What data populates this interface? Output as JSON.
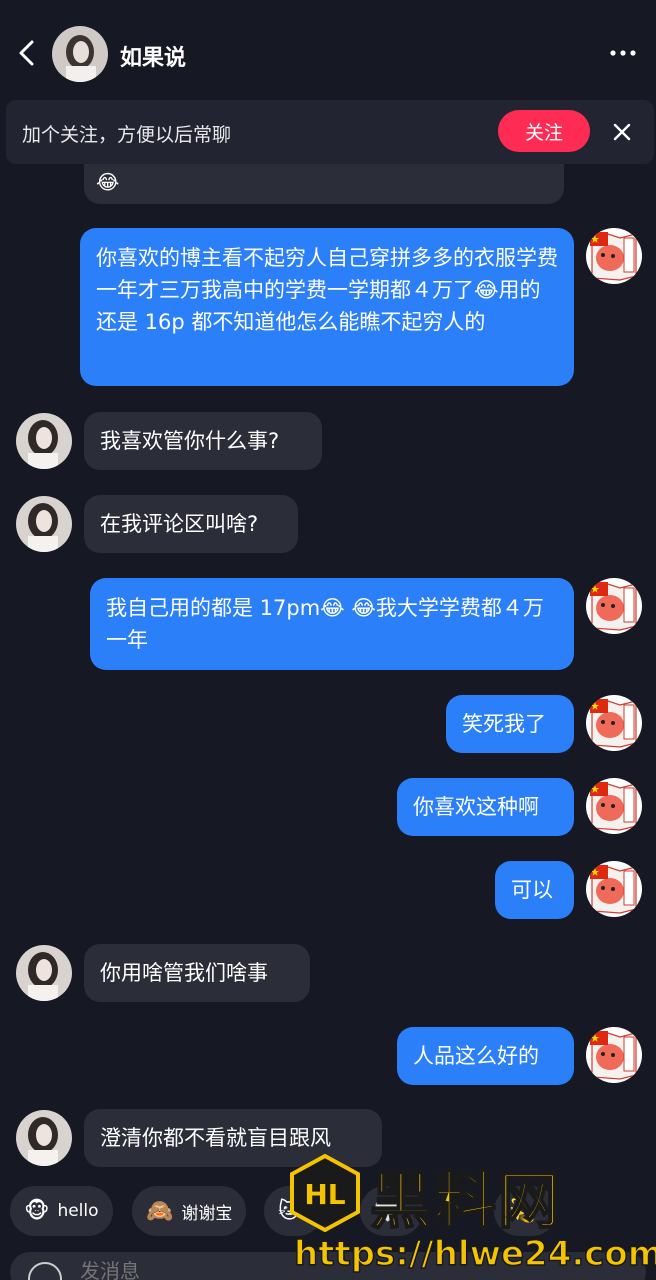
{
  "header": {
    "contact_name": "如果说"
  },
  "follow_banner": {
    "text": "加个关注，方便以后常聊",
    "button_label": "关注"
  },
  "partial_message": {
    "emoji": "😂"
  },
  "messages": [
    {
      "from": "me",
      "text": "你喜欢的博主看不起穷人自己穿拼多多的衣服学费一年才三万我高中的学费一学期都４万了😂用的还是 16p 都不知道他怎么能瞧不起穷人的"
    },
    {
      "from": "them",
      "text": "我喜欢管你什么事?"
    },
    {
      "from": "them",
      "text": "在我评论区叫啥?"
    },
    {
      "from": "me",
      "text": "我自己用的都是 17pm😂 😂我大学学费都４万一年"
    },
    {
      "from": "me",
      "text": "笑死我了"
    },
    {
      "from": "me",
      "text": "你喜欢这种啊"
    },
    {
      "from": "me",
      "text": "可以"
    },
    {
      "from": "them",
      "text": "你用啥管我们啥事"
    },
    {
      "from": "me",
      "text": "人品这么好的"
    },
    {
      "from": "them",
      "text": "澄清你都不看就盲目跟风"
    }
  ],
  "quick_replies": [
    {
      "icon": "monkey-icon",
      "glyph": "🐵",
      "label": "hello"
    },
    {
      "icon": "monkey-flower-icon",
      "glyph": "🙈",
      "label": "谢谢宝"
    },
    {
      "icon": "cat-icon",
      "glyph": "🐱",
      "label": ""
    },
    {
      "icon": "sticker-icon",
      "glyph": "🤍",
      "label": ""
    },
    {
      "icon": "sticker-icon-2",
      "glyph": "💫",
      "label": ""
    }
  ],
  "input": {
    "placeholder": "发消息"
  },
  "watermark": {
    "logo_text": "黑料网",
    "url": "https://hlwe24.com"
  },
  "colors": {
    "background": "#161823",
    "my_bubble": "#2b7ff8",
    "their_bubble": "#2b2d39",
    "follow_button": "#fe2c55",
    "watermark": "#f5c400"
  }
}
